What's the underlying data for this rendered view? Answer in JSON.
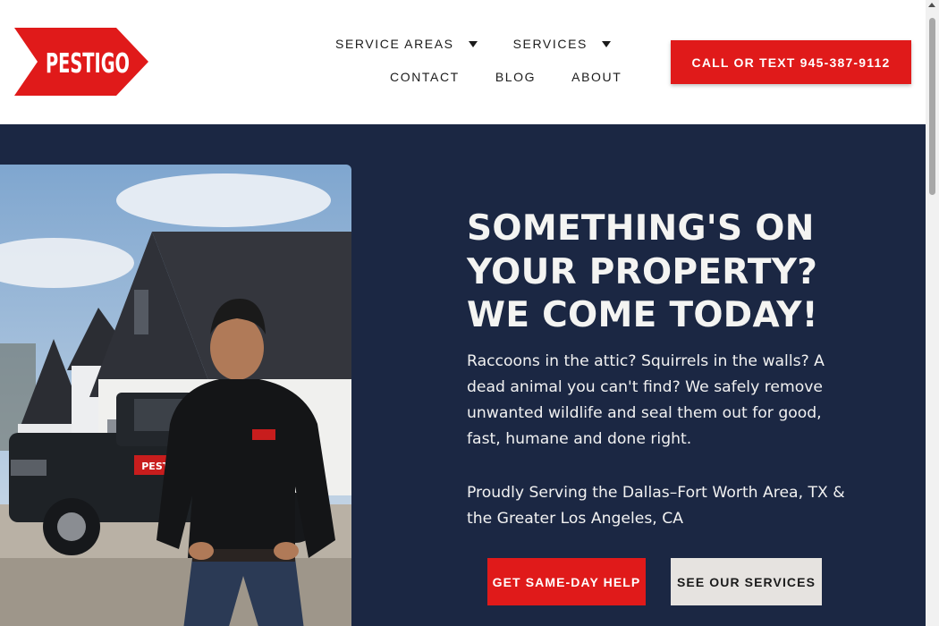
{
  "brand": {
    "logo_text": "PESTIGO",
    "red": "#e01a1a",
    "navy": "#1b2743"
  },
  "nav": {
    "row1": [
      {
        "label": "SERVICE AREAS",
        "has_dropdown": true
      },
      {
        "label": "SERVICES",
        "has_dropdown": true
      }
    ],
    "row2": [
      {
        "label": "CONTACT"
      },
      {
        "label": "BLOG"
      },
      {
        "label": "ABOUT"
      }
    ]
  },
  "header_cta": {
    "label": "CALL OR TEXT 945-387-9112"
  },
  "hero": {
    "title_lines": [
      "SOMETHING'S ON",
      "YOUR PROPERTY?",
      "WE COME TODAY!"
    ],
    "body": "Raccoons in the attic? Squirrels in the walls? A dead animal you can't find? We safely remove unwanted wildlife and seal them out for good, fast, humane and done right.",
    "service_area": "Proudly Serving the Dallas–Fort Worth Area, TX & the Greater Los Angeles, CA",
    "primary_button": "GET SAME-DAY HELP",
    "secondary_button": "SEE OUR SERVICES",
    "photo_badge_text": "PESTIGO"
  }
}
